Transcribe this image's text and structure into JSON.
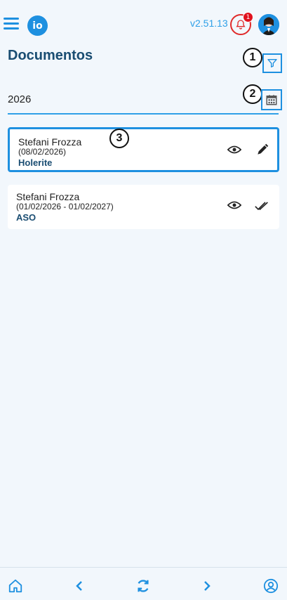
{
  "header": {
    "logo_text": "io",
    "version": "v2.51.13",
    "notification_count": "1",
    "accent_color": "#1e90e0"
  },
  "page": {
    "title": "Documentos"
  },
  "filters": {
    "year_value": "2026"
  },
  "callouts": [
    "1",
    "2",
    "3"
  ],
  "documents": [
    {
      "name": "Stefani Frozza",
      "date": "(08/02/2026)",
      "type": "Holerite",
      "action_icon": "pen-icon"
    },
    {
      "name": "Stefani Frozza",
      "date": "(01/02/2026 - 01/02/2027)",
      "type": "ASO",
      "action_icon": "double-check-icon"
    }
  ],
  "bottom_nav": [
    "home-icon",
    "chevron-left-icon",
    "refresh-icon",
    "chevron-right-icon",
    "profile-icon"
  ]
}
